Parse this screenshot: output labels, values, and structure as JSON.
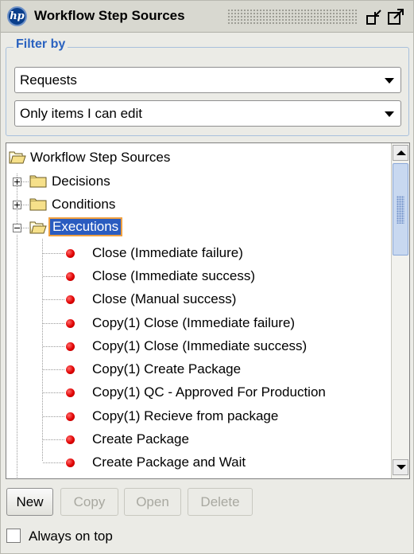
{
  "window": {
    "title": "Workflow Step Sources",
    "logo_text": "hp"
  },
  "filter": {
    "legend": "Filter by",
    "type_select": {
      "value": "Requests"
    },
    "scope_select": {
      "value": "Only items I can edit"
    }
  },
  "tree": {
    "root": {
      "label": "Workflow Step Sources",
      "icon": "folder-open-icon"
    },
    "folders": [
      {
        "label": "Decisions",
        "expanded": false,
        "icon": "folder-icon"
      },
      {
        "label": "Conditions",
        "expanded": false,
        "icon": "folder-icon"
      },
      {
        "label": "Executions",
        "expanded": true,
        "selected": true,
        "icon": "folder-open-icon"
      }
    ],
    "executions_items": [
      {
        "label": "Close (Immediate failure)",
        "icon": "red-dot-icon"
      },
      {
        "label": "Close (Immediate success)",
        "icon": "red-dot-icon"
      },
      {
        "label": "Close (Manual success)",
        "icon": "red-dot-icon"
      },
      {
        "label": "Copy(1) Close (Immediate failure)",
        "icon": "red-dot-icon"
      },
      {
        "label": "Copy(1) Close (Immediate success)",
        "icon": "red-dot-icon"
      },
      {
        "label": "Copy(1) Create Package",
        "icon": "red-dot-icon"
      },
      {
        "label": "Copy(1) QC - Approved For Production",
        "icon": "red-dot-icon"
      },
      {
        "label": "Copy(1) Recieve from package",
        "icon": "red-dot-icon"
      },
      {
        "label": "Create Package",
        "icon": "red-dot-icon"
      },
      {
        "label": "Create Package and Wait",
        "icon": "red-dot-icon"
      }
    ]
  },
  "buttons": {
    "new": "New",
    "copy": "Copy",
    "open": "Open",
    "delete": "Delete"
  },
  "always_on_top": {
    "label": "Always on top",
    "checked": false
  },
  "colors": {
    "accent": "#2a62c0",
    "selection": "#2a5cc0",
    "item_dot": "#e00000"
  }
}
